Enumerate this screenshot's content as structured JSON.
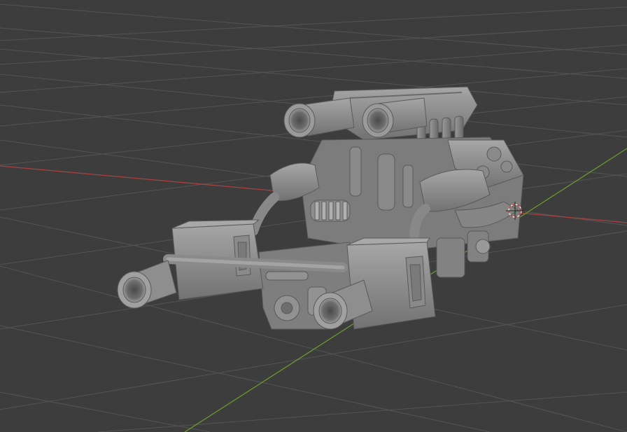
{
  "viewport": {
    "mode": "solid-shading",
    "object": "v8-engine-model",
    "background_color": "#3d3d3d",
    "grid_color": "#545454",
    "x_axis_color": "#a8403f",
    "y_axis_color": "#6a9a2c",
    "model_color": "#8f8f8f",
    "icons": {
      "cursor": "3d-cursor-icon"
    }
  }
}
